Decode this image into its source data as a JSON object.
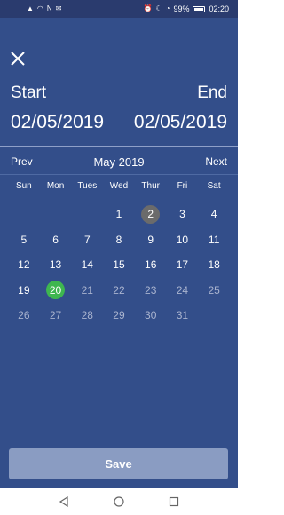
{
  "status": {
    "battery": "99%",
    "time": "02:20"
  },
  "range": {
    "start_label": "Start",
    "end_label": "End",
    "start_date": "02/05/2019",
    "end_date": "02/05/2019"
  },
  "calendar": {
    "prev_label": "Prev",
    "next_label": "Next",
    "month_label": "May 2019",
    "weekdays": [
      "Sun",
      "Mon",
      "Tues",
      "Wed",
      "Thur",
      "Fri",
      "Sat"
    ],
    "first_weekday_index": 3,
    "days_in_month": 31,
    "selected_day": 2,
    "today_day": 20,
    "past_through_day": 20
  },
  "actions": {
    "save_label": "Save"
  },
  "colors": {
    "background": "#334e8a",
    "today": "#3eb64f",
    "selected": "#6b6b6b",
    "save_button": "#8a9cc2"
  }
}
